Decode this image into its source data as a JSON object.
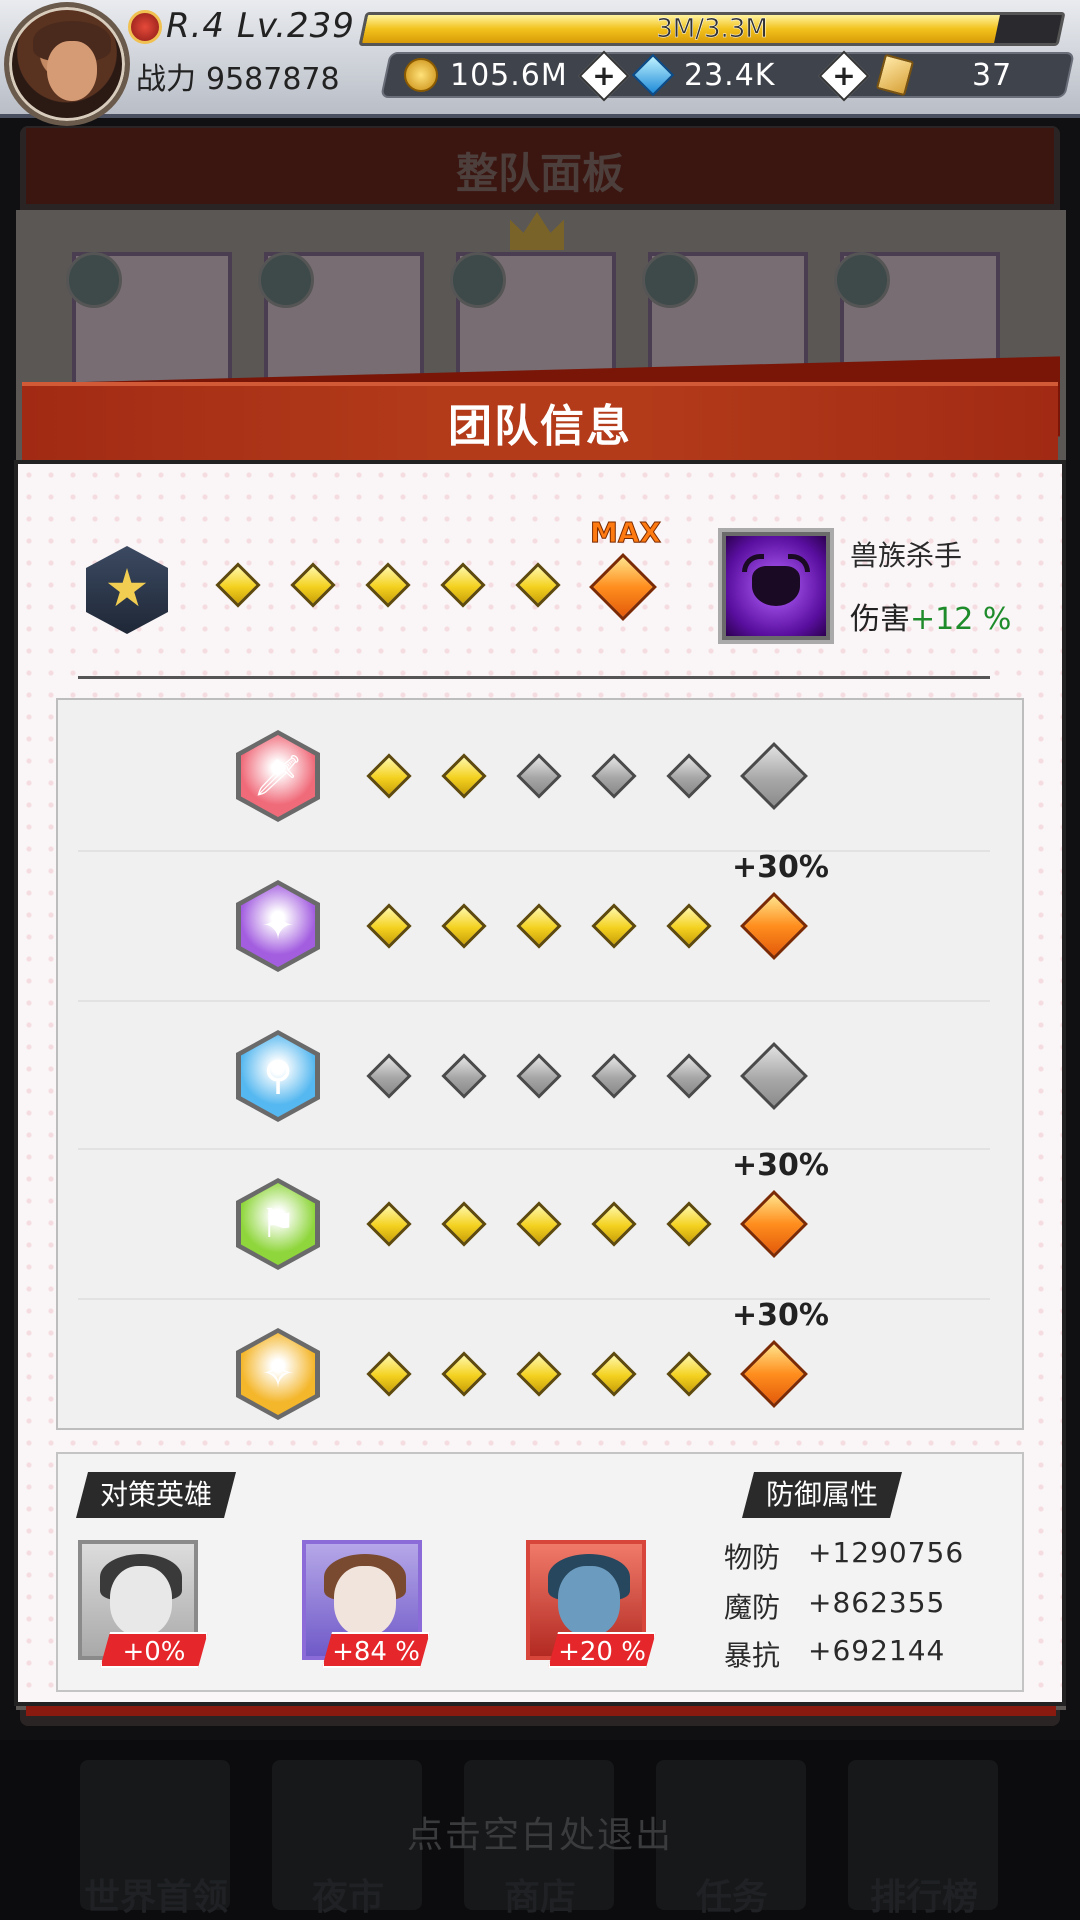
{
  "topbar": {
    "rank": "R.4 Lv.239",
    "exp_text": "3M/3.3M",
    "exp_progress": 0.91,
    "power_label": "战力",
    "power_value": "9587878",
    "gold": "105.6M",
    "diamonds": "23.4K",
    "tickets": "37"
  },
  "background": {
    "panel_title": "整队面板",
    "exit_hint": "点击空白处退出",
    "nav": [
      "世界首领",
      "夜市",
      "商店",
      "任务",
      "排行榜"
    ]
  },
  "dialog": {
    "title": "团队信息",
    "team": {
      "filled": 5,
      "total": 6,
      "max_label": "MAX",
      "bonus_name": "兽族杀手",
      "bonus_prefix": "伤害",
      "bonus_value": "+12 %",
      "bonus_icon": "bull-head-icon"
    },
    "classes": [
      {
        "icon": "sword-icon",
        "color": "#f06b7a",
        "filled": 2,
        "bonus": ""
      },
      {
        "icon": "shuriken-icon",
        "color": "#a35ee0",
        "filled": 5,
        "bonus": "+30%"
      },
      {
        "icon": "magic-staff-icon",
        "color": "#56b8f0",
        "filled": 0,
        "bonus": ""
      },
      {
        "icon": "flag-icon",
        "color": "#8fd63c",
        "filled": 5,
        "bonus": "+30%"
      },
      {
        "icon": "wings-icon",
        "color": "#f4b62a",
        "filled": 5,
        "bonus": "+30%"
      }
    ],
    "counter_heroes": {
      "label": "对策英雄",
      "heroes": [
        {
          "pct": "+0%",
          "frame": "#8a8a8a"
        },
        {
          "pct": "+84 %",
          "frame": "#8a6bd8"
        },
        {
          "pct": "+20 %",
          "frame": "#d8453a"
        }
      ]
    },
    "defense": {
      "label": "防御属性",
      "stats": [
        {
          "name": "物防",
          "value": "+1290756"
        },
        {
          "name": "魔防",
          "value": "+862355"
        },
        {
          "name": "暴抗",
          "value": "+692144"
        }
      ]
    }
  }
}
